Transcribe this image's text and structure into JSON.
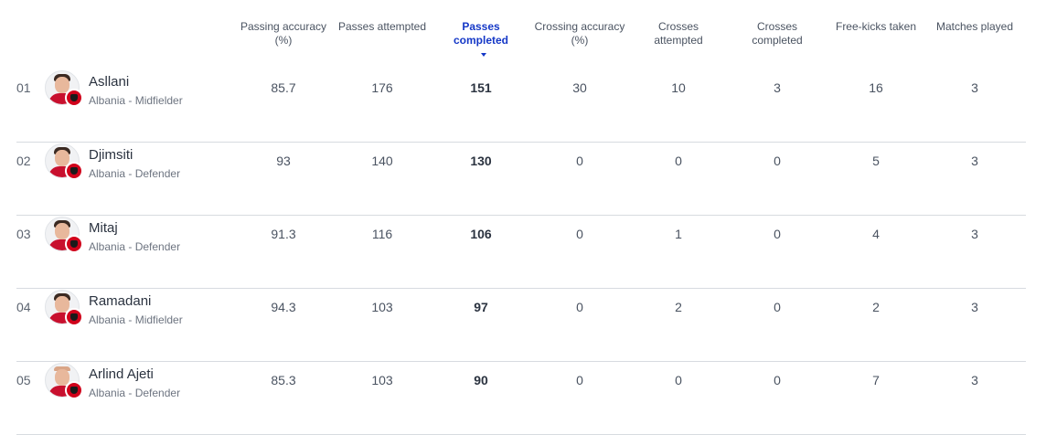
{
  "columns": [
    {
      "label": "Passing accuracy (%)"
    },
    {
      "label": "Passes attempted"
    },
    {
      "label": "Passes completed",
      "sorted": true
    },
    {
      "label": "Crossing accuracy (%)"
    },
    {
      "label": "Crosses attempted"
    },
    {
      "label": "Crosses completed"
    },
    {
      "label": "Free-kicks taken"
    },
    {
      "label": "Matches played"
    }
  ],
  "rows": [
    {
      "rank": "01",
      "name": "Asllani",
      "detail": "Albania - Midfielder",
      "values": [
        "85.7",
        "176",
        "151",
        "30",
        "10",
        "3",
        "16",
        "3"
      ]
    },
    {
      "rank": "02",
      "name": "Djimsiti",
      "detail": "Albania - Defender",
      "values": [
        "93",
        "140",
        "130",
        "0",
        "0",
        "0",
        "5",
        "3"
      ]
    },
    {
      "rank": "03",
      "name": "Mitaj",
      "detail": "Albania - Defender",
      "values": [
        "91.3",
        "116",
        "106",
        "0",
        "1",
        "0",
        "4",
        "3"
      ]
    },
    {
      "rank": "04",
      "name": "Ramadani",
      "detail": "Albania - Midfielder",
      "values": [
        "94.3",
        "103",
        "97",
        "0",
        "2",
        "0",
        "2",
        "3"
      ]
    },
    {
      "rank": "05",
      "name": "Arlind Ajeti",
      "detail": "Albania - Defender",
      "values": [
        "85.3",
        "103",
        "90",
        "0",
        "0",
        "0",
        "7",
        "3"
      ]
    }
  ],
  "colors": {
    "accent": "#1538c7",
    "flag": "#d0021b",
    "divider": "#d7dbe0"
  }
}
